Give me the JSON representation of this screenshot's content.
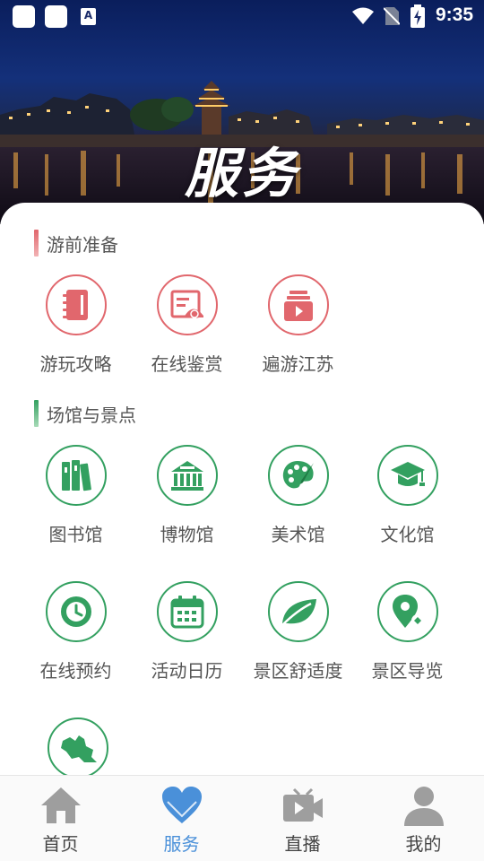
{
  "status_bar": {
    "time": "9:35",
    "a_badge": "A"
  },
  "hero": {
    "title": "服务"
  },
  "sections": [
    {
      "title": "游前准备",
      "accent": "#e1676d",
      "items": [
        {
          "label": "游玩攻略",
          "icon": "notebook-icon"
        },
        {
          "label": "在线鉴赏",
          "icon": "exhibit-board-icon"
        },
        {
          "label": "遍游江苏",
          "icon": "play-video-icon"
        }
      ]
    },
    {
      "title": "场馆与景点",
      "accent": "#33a060",
      "items": [
        {
          "label": "图书馆",
          "icon": "books-icon"
        },
        {
          "label": "博物馆",
          "icon": "museum-icon"
        },
        {
          "label": "美术馆",
          "icon": "palette-icon"
        },
        {
          "label": "文化馆",
          "icon": "graduation-cap-icon"
        },
        {
          "label": "在线预约",
          "icon": "clock-icon"
        },
        {
          "label": "活动日历",
          "icon": "calendar-icon"
        },
        {
          "label": "景区舒适度",
          "icon": "leaf-icon"
        },
        {
          "label": "景区导览",
          "icon": "map-pin-icon"
        },
        {
          "label": "",
          "icon": "jiangsu-map-icon"
        }
      ]
    }
  ],
  "bottom_nav": [
    {
      "label": "首页",
      "icon": "home-icon",
      "active": false
    },
    {
      "label": "服务",
      "icon": "heart-icon",
      "active": true
    },
    {
      "label": "直播",
      "icon": "video-camera-icon",
      "active": false
    },
    {
      "label": "我的",
      "icon": "user-icon",
      "active": false
    }
  ],
  "colors": {
    "red_accent": "#e1676d",
    "green_accent": "#33a060",
    "nav_active": "#4a90d9",
    "nav_inactive": "#9e9e9e"
  }
}
